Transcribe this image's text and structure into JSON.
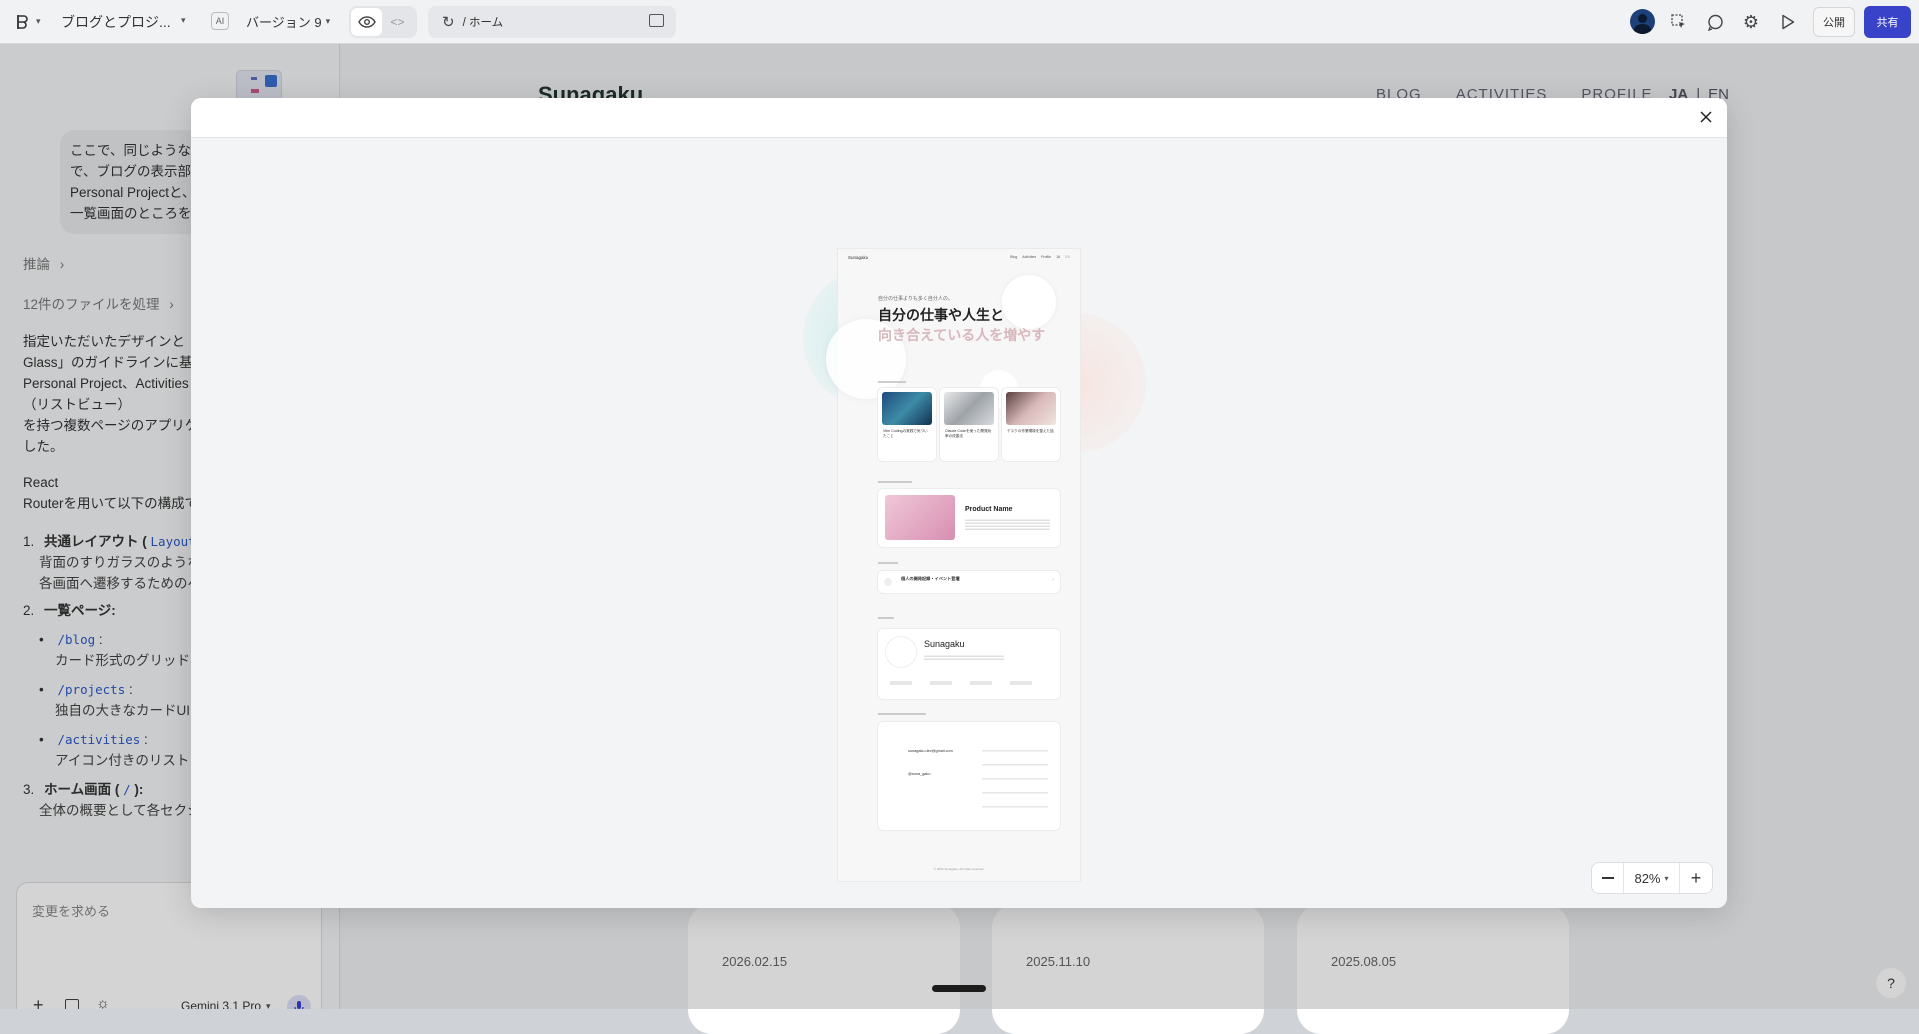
{
  "topbar": {
    "project_title": "ブログとプロジ...",
    "ai_badge": "AI",
    "version_label": "バージョン 9",
    "address": "/ ホーム",
    "publish_label": "公開",
    "share_label": "共有"
  },
  "chat": {
    "user_message_lines": [
      "ここで、同じような",
      "で、ブログの表示部",
      "Personal Projectと、",
      "一覧画面のところを"
    ],
    "reasoning_label": "推論",
    "files_processed_label": "12件のファイルを処理",
    "response_lines": [
      "指定いただいたデザインと「",
      "Glass」のガイドラインに基づ",
      "Personal Project、Activities",
      "（リストビュー）",
      "を持つ複数ページのアプリケ",
      "した。"
    ],
    "react_line1": "React",
    "react_line2": "Routerを用いて以下の構成で",
    "list": [
      {
        "num": "1.",
        "title": "共通レイアウト ( ",
        "code": "Layout",
        "desc_lines": [
          "背面のすりガラスのような",
          "各画面へ遷移するためのへ"
        ]
      },
      {
        "num": "2.",
        "title": "一覧ページ:"
      },
      {
        "num": "3.",
        "title": "ホーム画面 ( ",
        "code": "/",
        "title_end": " ):",
        "desc_lines": [
          "全体の概要として各セクシ"
        ]
      }
    ],
    "subitems": [
      {
        "code": "/blog",
        "colon": " :",
        "desc": "カード形式のグリッドL"
      },
      {
        "code": "/projects",
        "colon": " :",
        "desc": "独自の大きなカードUIで"
      },
      {
        "code": "/activities",
        "colon": " :",
        "desc": "アイコン付きのリストア"
      }
    ]
  },
  "prompt": {
    "placeholder": "変更を求める",
    "model_label": "Gemini 3.1 Pro"
  },
  "background_site": {
    "logo": "Sunagaku",
    "nav": [
      "BLOG",
      "ACTIVITIES",
      "PROFILE"
    ],
    "lang_ja": "JA",
    "lang_sep": "|",
    "lang_en": "EN",
    "card_dates": [
      "2026.02.15",
      "2025.11.10",
      "2025.08.05"
    ]
  },
  "modal": {
    "zoom_level": "82%"
  },
  "preview": {
    "logo": "Sunagaku",
    "nav": [
      "Blog",
      "Activities",
      "Profile",
      "JA",
      "EN"
    ],
    "hero_small": "自分の仕事よりも多く自分人の。",
    "hero_line1": "自分の仕事や人生と",
    "hero_line2": "向き合えている人を増やす",
    "blog_cards": [
      {
        "title": "Vibe Codingの実践で気づいたこと"
      },
      {
        "title": "Claude Codeを使った開発効率の改善法"
      },
      {
        "title": "デスクの作業環境を整えた話"
      }
    ],
    "project_name": "Product Name",
    "activity_title": "個人の開発記録・イベント登壇",
    "profile_name": "Sunagaku",
    "contact_email": "sunagaku.dev@gmail.com",
    "contact_handle": "@sona_gaku",
    "footer": "© 2026 Sunagaku. All rights reserved."
  },
  "colors": {
    "accent": "#3843c9",
    "link_code": "#2d57c9"
  }
}
